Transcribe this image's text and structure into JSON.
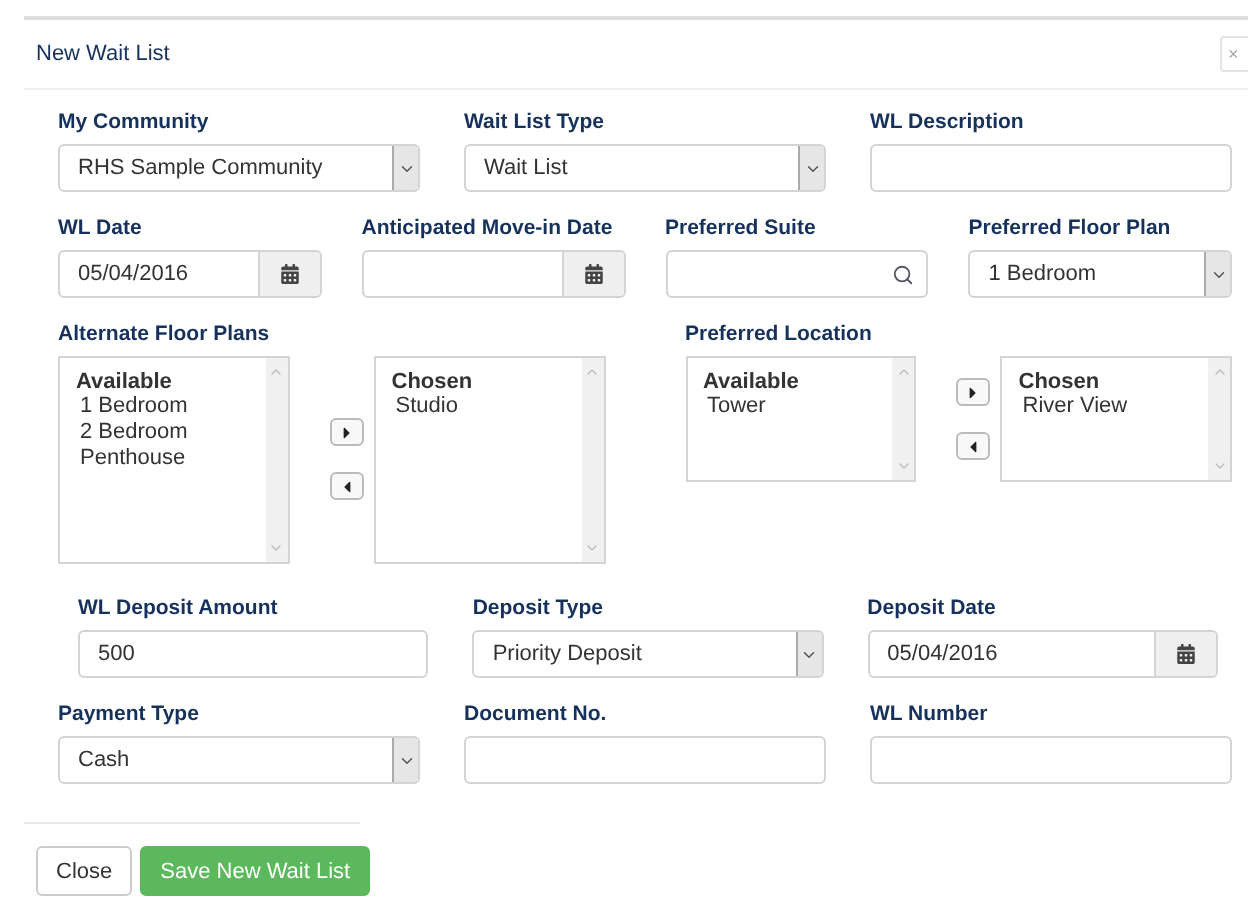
{
  "dialog": {
    "title": "New Wait List",
    "close": "×"
  },
  "rows": [
    {
      "fields": [
        {
          "kind": "select",
          "label": "My Community",
          "value": "RHS Sample Community"
        },
        {
          "kind": "select",
          "label": "Wait List Type",
          "value": "Wait List"
        },
        {
          "kind": "text",
          "label": "WL Description"
        }
      ]
    },
    {
      "fields": [
        {
          "kind": "date",
          "label": "WL Date",
          "value": "05/04/2016"
        },
        {
          "kind": "date",
          "label": "Anticipated Move-in Date"
        },
        {
          "kind": "lookup",
          "label": "Preferred Suite"
        },
        {
          "kind": "select",
          "label": "Preferred Floor Plan",
          "value": "1 Bedroom"
        }
      ]
    }
  ],
  "dual_lists": [
    {
      "label": "Alternate Floor Plans",
      "available": {
        "heading": "Available",
        "items": [
          "1 Bedroom",
          "2 Bedroom",
          "Penthouse"
        ]
      },
      "chosen": {
        "heading": "Chosen",
        "items": [
          "Studio"
        ]
      }
    },
    {
      "label": "Preferred Location",
      "available": {
        "heading": "Available",
        "items": [
          "Tower"
        ]
      },
      "chosen": {
        "heading": "Chosen",
        "items": [
          "River View"
        ]
      }
    }
  ],
  "rows_after": [
    {
      "fields": [
        {
          "kind": "text",
          "label": "WL Deposit Amount",
          "value": "500"
        },
        {
          "kind": "select",
          "label": "Deposit Type",
          "value": "Priority Deposit"
        },
        {
          "kind": "date",
          "label": "Deposit Date",
          "value": "05/04/2016"
        }
      ]
    },
    {
      "fields": [
        {
          "kind": "select",
          "label": "Payment Type",
          "value": "Cash"
        },
        {
          "kind": "text",
          "label": "Document No."
        },
        {
          "kind": "text",
          "label": "WL Number"
        }
      ]
    }
  ],
  "buttons": [
    {
      "kind": "default",
      "label": "Close"
    },
    {
      "kind": "primary",
      "label": "Save New Wait List"
    }
  ]
}
